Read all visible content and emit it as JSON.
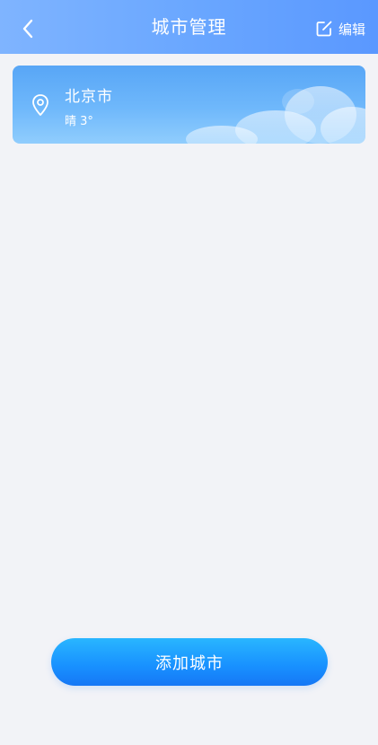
{
  "header": {
    "title": "城市管理",
    "back_icon": "chevron-left-icon",
    "edit_label": "编辑",
    "edit_icon": "edit-square-icon"
  },
  "cities": [
    {
      "name": "北京市",
      "weather": "晴 3°",
      "icon": "location-pin-icon"
    }
  ],
  "footer": {
    "add_city_label": "添加城市"
  },
  "colors": {
    "header_gradient_start": "#7fb4ff",
    "header_gradient_end": "#5a98ff",
    "background": "#f2f3f7",
    "card_gradient_top": "#58a6f6",
    "card_gradient_bottom": "#90cdfd",
    "button_gradient_top": "#29b6ff",
    "button_gradient_bottom": "#1677f5"
  }
}
